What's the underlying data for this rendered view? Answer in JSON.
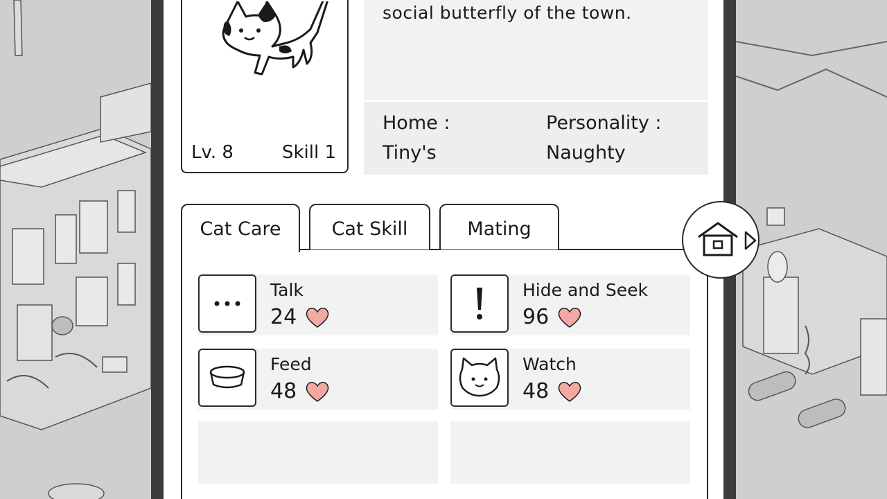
{
  "cat": {
    "description_line": "social butterfly of the town.",
    "level": "Lv. 8",
    "skill": "Skill 1"
  },
  "info": {
    "home_label": "Home :",
    "home_value": "Tiny's",
    "personality_label": "Personality :",
    "personality_value": "Naughty"
  },
  "tabs": [
    {
      "label": "Cat Care",
      "active": true
    },
    {
      "label": "Cat Skill",
      "active": false
    },
    {
      "label": "Mating",
      "active": false
    }
  ],
  "actions": [
    {
      "name": "Talk",
      "value": "24",
      "icon": "speech-dots-icon"
    },
    {
      "name": "Hide and Seek",
      "value": "96",
      "icon": "exclamation-icon"
    },
    {
      "name": "Feed",
      "value": "48",
      "icon": "food-bowl-icon"
    },
    {
      "name": "Watch",
      "value": "48",
      "icon": "cat-face-icon"
    }
  ],
  "nav": {
    "icon": "home-icon",
    "arrow": "arrow-right-icon"
  },
  "colors": {
    "heart": "#f2a9a4",
    "frame": "#3c3c3c",
    "panel_gray": "#f2f2f2"
  }
}
